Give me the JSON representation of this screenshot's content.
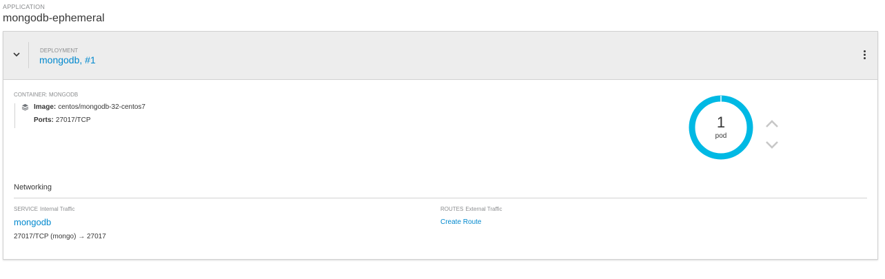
{
  "application": {
    "label": "APPLICATION",
    "name": "mongodb-ephemeral"
  },
  "deployment": {
    "label": "DEPLOYMENT",
    "name": "mongodb, #1"
  },
  "container": {
    "label": "CONTAINER: MONGODB",
    "image_key": "Image:",
    "image_value": "centos/mongodb-32-centos7",
    "ports_key": "Ports:",
    "ports_value": "27017/TCP"
  },
  "pods": {
    "count": "1",
    "label": "pod",
    "ring_color": "#00b9e4"
  },
  "networking": {
    "title": "Networking",
    "service": {
      "label": "SERVICE",
      "sublabel": "Internal Traffic",
      "name": "mongodb",
      "port_mapping": "27017/TCP (mongo) → 27017"
    },
    "routes": {
      "label": "ROUTES",
      "sublabel": "External Traffic",
      "action": "Create Route"
    }
  },
  "colors": {
    "link": "#0088ce",
    "header_bg": "#ededed",
    "border": "#d1d1d1"
  },
  "icons": [
    "chevron-down-icon",
    "kebab-menu-icon",
    "layers-icon",
    "chevron-up-icon",
    "chevron-down-icon"
  ]
}
